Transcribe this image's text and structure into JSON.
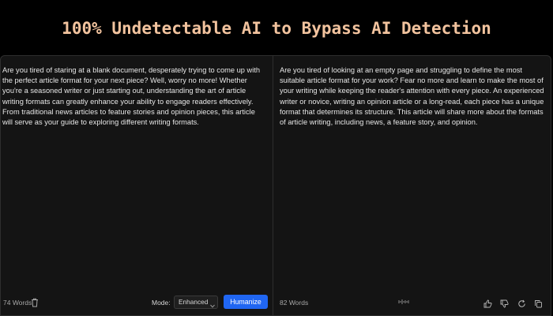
{
  "header": {
    "title": "100% Undetectable AI to Bypass AI Detection"
  },
  "input_pane": {
    "text": "Are you tired of staring at a blank document, desperately trying to come up with the perfect article format for your next piece? Well, worry no more! Whether you're a seasoned writer or just starting out, understanding the art of article writing formats can greatly enhance your ability to engage readers effectively. From traditional news articles to feature stories and opinion pieces, this article will serve as your guide to exploring different writing formats.",
    "word_count": "74 Words",
    "mode_label": "Mode:",
    "mode_value": "Enhanced",
    "humanize_label": "Humanize"
  },
  "output_pane": {
    "text": "Are you tired of looking at an empty page and struggling to define the most suitable article format for your work? Fear no more and learn to make the most of your writing while keeping the reader's attention with every piece. An experienced writer or novice, writing an opinion article or a long-read, each piece has a unique format that determines its structure. This article will share more about the formats of article writing, including news, a feature story, and opinion.",
    "word_count": "82 Words"
  },
  "icons": {
    "trash": "trash-icon",
    "chevron": "chevron-down-icon",
    "wave": "sound-wave-icon",
    "thumbs_up": "thumbs-up-icon",
    "thumbs_down": "thumbs-down-icon",
    "regenerate": "refresh-icon",
    "copy": "copy-icon"
  },
  "colors": {
    "title": "#f2c39e",
    "accent": "#2066f2",
    "panel": "#141414"
  }
}
